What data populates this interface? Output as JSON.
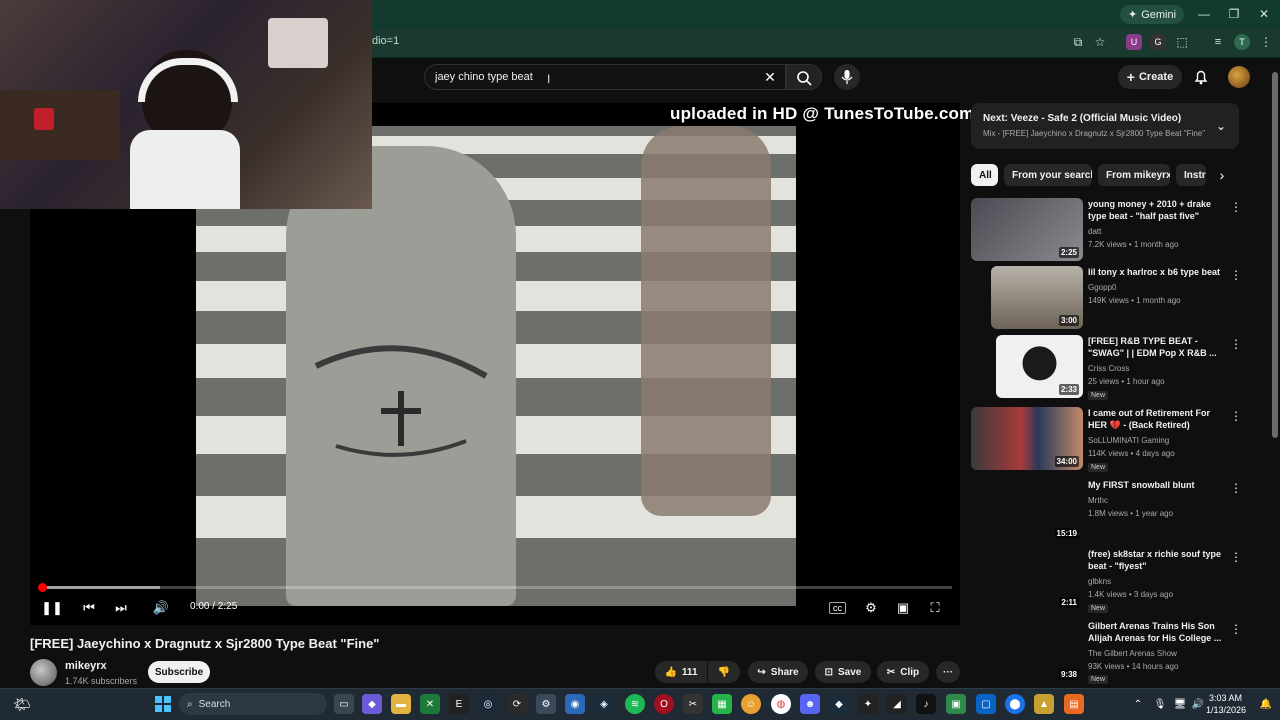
{
  "browser": {
    "gemini_label": "Gemini",
    "url_fragment": "dio=1"
  },
  "header": {
    "search_value": "jaey chino type beat",
    "create_label": "Create"
  },
  "video": {
    "watermark": "uploaded in HD @ TunesToTube.com",
    "timecode": "0:00 / 2:25",
    "progress_buffered": 0.13,
    "title": "[FREE] Jaeychino x Dragnutz x Sjr2800 Type Beat \"Fine\"",
    "channel_name": "mikeyrx",
    "channel_subs": "1.74K subscribers",
    "subscribe_label": "Subscribe",
    "like_count": "111",
    "share_label": "Share",
    "save_label": "Save",
    "clip_label": "Clip"
  },
  "next": {
    "title": "Next: Veeze - Safe 2 (Official Music Video)",
    "subtitle": "Mix - [FREE] Jaeychino x Dragnutz x Sjr2800 Type Beat \"Fine\""
  },
  "chips": [
    "All",
    "From your search",
    "From mikeyrx",
    "Instr"
  ],
  "recommendations": [
    {
      "title": "young money + 2010 + drake type beat - \"half past five\"",
      "channel": "datt",
      "meta": "7.2K views • 1 month ago",
      "duration": "2:25",
      "new": "",
      "thumb": "#6a6a70"
    },
    {
      "title": "lil tony x harlroc x b6 type beat",
      "channel": "Ggopp0",
      "meta": "149K views • 1 month ago",
      "duration": "3:00",
      "new": "",
      "thumb": "#8c8478"
    },
    {
      "title": "[FREE] R&B TYPE BEAT - \"SWAG\" | | EDM Pop X R&B ...",
      "channel": "Criss Cross",
      "meta": "25 views • 1 hour ago",
      "duration": "2:33",
      "new": "New",
      "thumb": "#e8e8e8"
    },
    {
      "title": "I came out of Retirement For HER 💔 - (Back Retired)",
      "channel": "SoLLUMINATI Gaming",
      "meta": "114K views • 4 days ago",
      "duration": "34:00",
      "new": "New",
      "thumb": "#7a2a2a"
    },
    {
      "title": "My FIRST snowball blunt",
      "channel": "Mrthc",
      "meta": "1.8M views • 1 year ago",
      "duration": "15:19",
      "new": "",
      "thumb": "#0f0f0f"
    },
    {
      "title": "(free) sk8star x richie souf type beat - \"flyest\"",
      "channel": "glbkns",
      "meta": "1.4K views • 3 days ago",
      "duration": "2:11",
      "new": "New",
      "thumb": "#0f0f0f"
    },
    {
      "title": "Gilbert Arenas Trains His Son Alijah Arenas for His College ...",
      "channel": "The Gilbert Arenas Show",
      "meta": "93K views • 14 hours ago",
      "duration": "9:38",
      "new": "New",
      "thumb": "#0f0f0f"
    }
  ],
  "taskbar": {
    "search_label": "Search",
    "time": "3:03 AM",
    "date": "1/13/2026"
  },
  "colors": {
    "accent_red": "#ff0000",
    "browser_green": "#123a2e"
  }
}
